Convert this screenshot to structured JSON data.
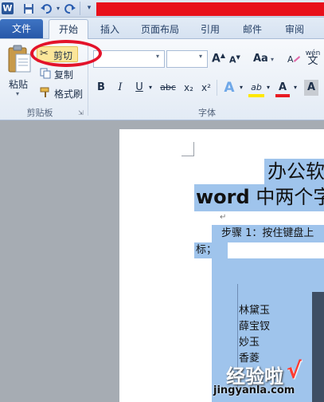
{
  "titlebar": {
    "app_letter": "W",
    "save_icon": "save-icon",
    "undo_icon": "undo-icon",
    "redo_icon": "redo-icon"
  },
  "tabs": {
    "file": "文件",
    "home": "开始",
    "insert": "插入",
    "page_layout": "页面布局",
    "references": "引用",
    "mailings": "邮件",
    "review": "审阅"
  },
  "clipboard": {
    "paste": "粘贴",
    "cut": "剪切",
    "copy": "复制",
    "format_painter": "格式刷",
    "group_label": "剪贴板"
  },
  "font": {
    "group_label": "字体",
    "grow_font": "A",
    "shrink_font": "A",
    "change_case": "Aa",
    "bold": "B",
    "italic": "I",
    "underline": "U",
    "strikethrough": "abc",
    "subscript": "x₂",
    "superscript": "x²",
    "text_effects": "A",
    "highlight": "ab",
    "font_color": "A",
    "char_shading": "A",
    "phonetic": "wén"
  },
  "document": {
    "title_line1": "办公软",
    "title_line2_word": "word",
    "title_line2_rest": " 中两个字",
    "step_line": "步骤 1：按住键盘上",
    "step_line2": "标；",
    "names": [
      "林黛玉",
      "薛宝钗",
      "妙玉",
      "香菱"
    ]
  },
  "watermark": {
    "text": "经验啦",
    "check": "√",
    "url": "jingyanla.com"
  },
  "colors": {
    "accent": "#2657a8",
    "highlight_ring": "#e3122a",
    "selection": "#9fc4ec",
    "title_bar_red": "#e8101a"
  }
}
